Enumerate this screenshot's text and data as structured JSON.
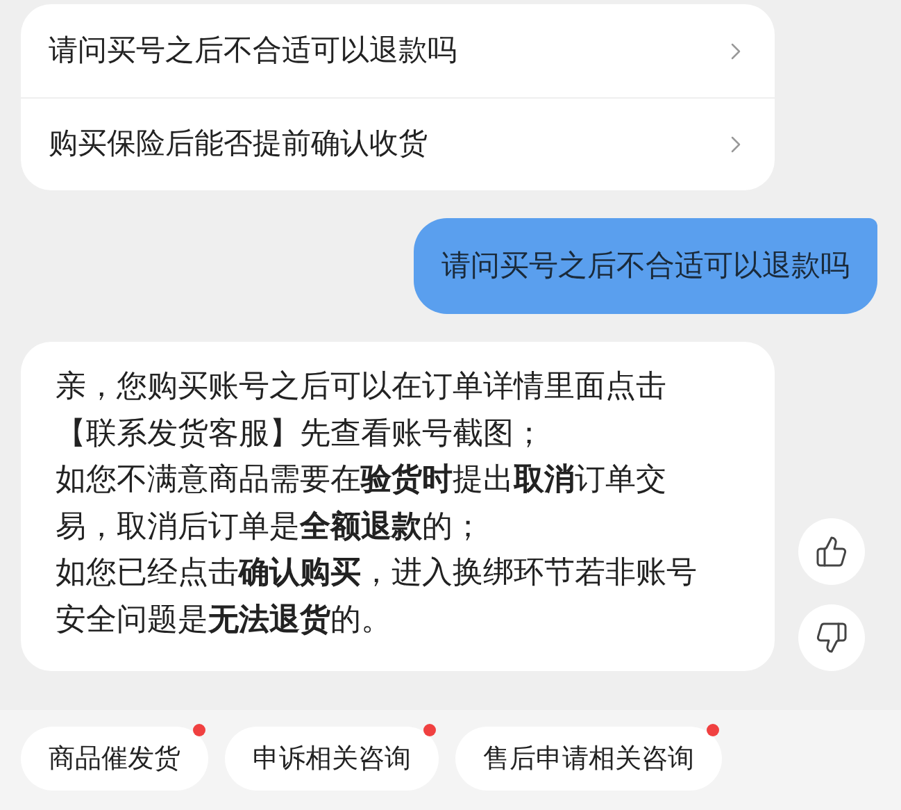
{
  "quick_questions": [
    {
      "label": "请问买号之后不合适可以退款吗"
    },
    {
      "label": "购买保险后能否提前确认收货"
    }
  ],
  "user_message": {
    "text": "请问买号之后不合适可以退款吗"
  },
  "reply": {
    "lines": [
      "亲，您购买账号之后可以在订单详情里面点击",
      "【联系发货客服】先查看账号截图；",
      "如您不满意商品需要在**验货时**提出**取消**订单交",
      "易，取消后订单是**全额退款**的；",
      "如您已经点击**确认购买**，进入换绑环节若非账号",
      "安全问题是**无法退货**的。"
    ]
  },
  "feedback": [
    {
      "kind": "like"
    },
    {
      "kind": "dislike"
    }
  ],
  "chips": [
    {
      "label": "商品催发货",
      "badge": true
    },
    {
      "label": "申诉相关咨询",
      "badge": true
    },
    {
      "label": "售后申请相关咨询",
      "badge": true
    }
  ]
}
